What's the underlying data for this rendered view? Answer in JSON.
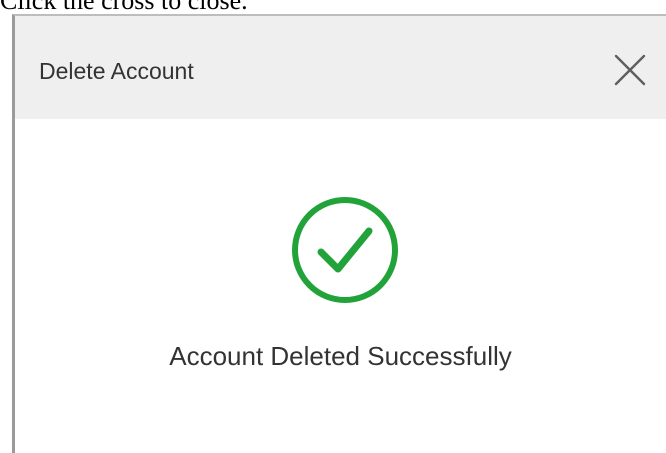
{
  "instruction": "Click the cross to close.",
  "dialog": {
    "title": "Delete Account",
    "close_icon": "close-icon",
    "success_icon": "check-circle-icon",
    "message": "Account Deleted Successfully"
  },
  "colors": {
    "header_background": "#efefef",
    "success_green": "#22a33a",
    "text": "#333333"
  }
}
